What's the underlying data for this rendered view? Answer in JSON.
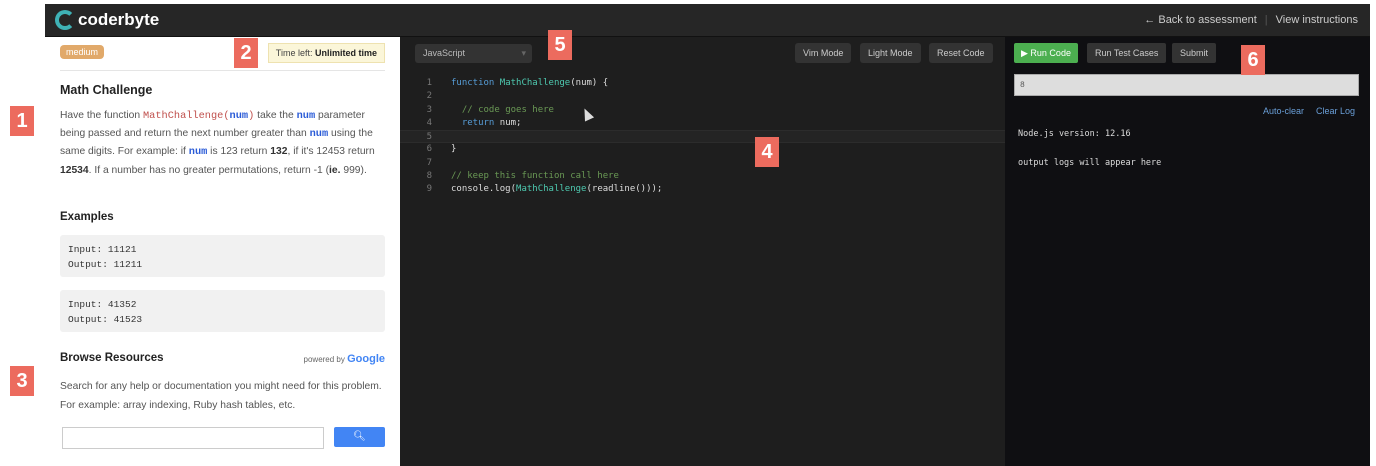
{
  "header": {
    "brand": "coderbyte",
    "back": "← Back to assessment",
    "instructions": "View instructions"
  },
  "left": {
    "difficulty": "medium",
    "time_label": "Time left:",
    "time_value": "Unlimited time",
    "title": "Math Challenge",
    "desc": {
      "p1": "Have the function ",
      "fn": "MathChallenge(",
      "arg": "num",
      "close": ")",
      "p2": " take the ",
      "num": "num",
      "p3": " parameter being passed and return the next number greater than ",
      "p4": " using the same digits. For example: if ",
      "p5": " is 123 return ",
      "b1": "132",
      "p6": ", if it's 12453 return ",
      "b2": "12534",
      "p7": ". If a number has no greater permutations, return -1 (",
      "b3": "ie.",
      "p8": " 999)."
    },
    "examples_title": "Examples",
    "examples": [
      {
        "input": "Input: 11121",
        "output": "Output: 11211"
      },
      {
        "input": "Input: 41352",
        "output": "Output: 41523"
      }
    ],
    "browse_title": "Browse Resources",
    "powered_by": "powered by",
    "google": "Google",
    "browse_desc": "Search for any help or documentation you might need for this problem. For example: array indexing, Ruby hash tables, etc.",
    "search_value": "",
    "search_icon": "search-icon"
  },
  "editor": {
    "language": "JavaScript",
    "vim": "Vim Mode",
    "light": "Light Mode",
    "reset": "Reset Code",
    "lines": [
      {
        "n": "1"
      },
      {
        "n": "2"
      },
      {
        "n": "3"
      },
      {
        "n": "4"
      },
      {
        "n": "5"
      },
      {
        "n": "6"
      },
      {
        "n": "7"
      },
      {
        "n": "8"
      },
      {
        "n": "9"
      }
    ],
    "tok": {
      "function": "function",
      "fname": "MathChallenge",
      "sig": "(num) {",
      "cm1": "// code goes here",
      "ret": "return",
      "retv": " num;",
      "close": "}",
      "cm2": "// keep this function call here",
      "log1": "console.log(",
      "log2": "(readline()));"
    }
  },
  "console": {
    "run": "▶ Run Code",
    "tests": "Run Test Cases",
    "submit": "Submit",
    "input": "8",
    "autoclear": "Auto-clear",
    "clear": "Clear Log",
    "version": "Node.js version: 12.16",
    "placeholder": "output logs will appear here"
  },
  "markers": [
    "1",
    "2",
    "3",
    "4",
    "5",
    "6"
  ]
}
